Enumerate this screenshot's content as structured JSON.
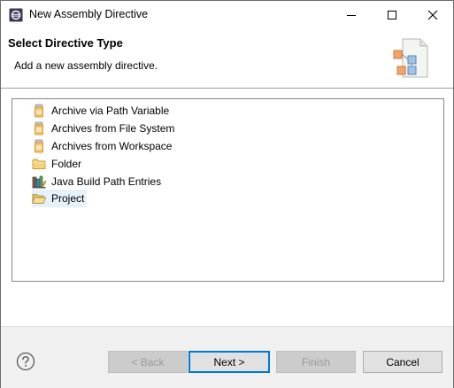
{
  "window": {
    "title": "New Assembly Directive",
    "controls": {
      "minimize": "minimize",
      "maximize": "maximize",
      "close": "close"
    }
  },
  "header": {
    "title": "Select Directive Type",
    "description": "Add a new assembly directive."
  },
  "tree": {
    "items": [
      {
        "label": "Archive via Path Variable",
        "icon": "jar-icon",
        "selected": false
      },
      {
        "label": "Archives from File System",
        "icon": "jar-icon",
        "selected": false
      },
      {
        "label": "Archives from Workspace",
        "icon": "jar-icon",
        "selected": false
      },
      {
        "label": "Folder",
        "icon": "folder-icon",
        "selected": false
      },
      {
        "label": "Java Build Path Entries",
        "icon": "library-icon",
        "selected": false
      },
      {
        "label": "Project",
        "icon": "open-folder-icon",
        "selected": true
      }
    ]
  },
  "buttons": {
    "back": "< Back",
    "next": "Next >",
    "finish": "Finish",
    "cancel": "Cancel"
  },
  "colors": {
    "selection": "#e5f1fb",
    "default_button_border": "#0078d7",
    "button_bar": "#f0f0f0",
    "jar": "#e8a33a",
    "folder": "#e8b84a"
  }
}
